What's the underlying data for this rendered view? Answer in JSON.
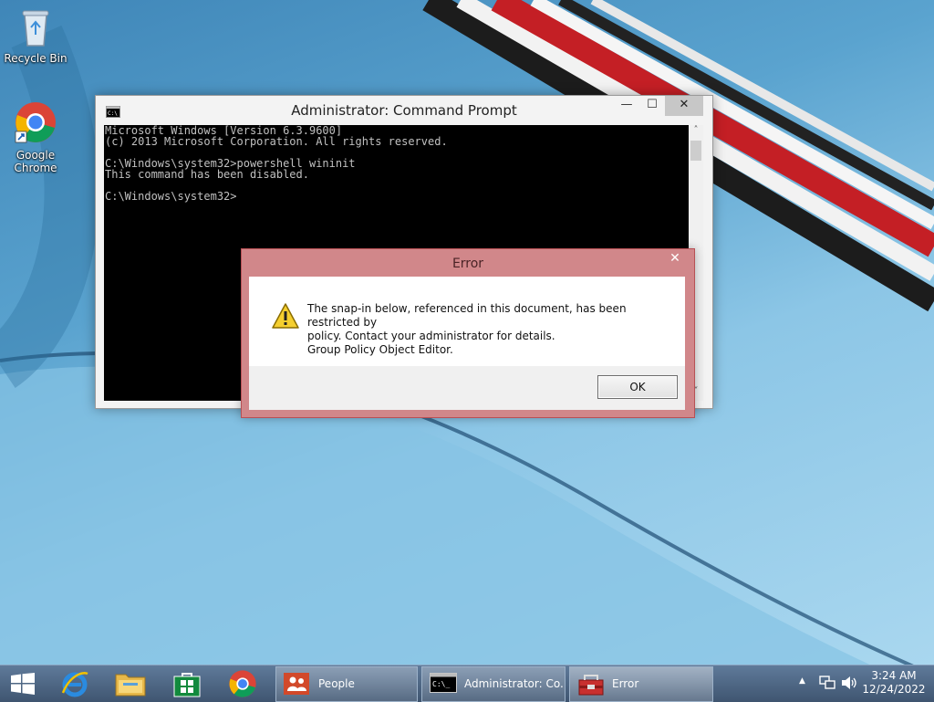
{
  "desktop": {
    "icons": [
      {
        "label": "Recycle Bin",
        "icon": "recycle-bin-icon"
      },
      {
        "label": "Google Chrome",
        "icon": "chrome-icon"
      }
    ]
  },
  "cmd": {
    "title": "Administrator: Command Prompt",
    "buttons": {
      "minimize": "—",
      "maximize": "☐",
      "close": "✕"
    },
    "console_text": "Microsoft Windows [Version 6.3.9600]\n(c) 2013 Microsoft Corporation. All rights reserved.\n\nC:\\Windows\\system32>powershell wininit\nThis command has been disabled.\n\nC:\\Windows\\system32>",
    "scroll_up": "˄",
    "scroll_down": "˅"
  },
  "error_dialog": {
    "title": "Error",
    "close": "✕",
    "message_line1": "The snap-in below, referenced in this document, has been restricted by",
    "message_line2": "policy. Contact your administrator for details.",
    "message_line3": "Group Policy Object Editor.",
    "ok_label": "OK"
  },
  "taskbar": {
    "pinned": [
      {
        "icon": "windows-start-icon"
      },
      {
        "icon": "internet-explorer-icon"
      },
      {
        "icon": "file-explorer-icon"
      },
      {
        "icon": "store-icon"
      },
      {
        "icon": "chrome-icon"
      }
    ],
    "tasks": [
      {
        "label": "People",
        "icon": "people-icon"
      },
      {
        "label": "Administrator: Co...",
        "icon": "cmd-icon"
      },
      {
        "label": "Error",
        "icon": "error-app-icon"
      }
    ],
    "tray": {
      "show_hidden": "▲",
      "network_icon": "network-icon",
      "volume_icon": "volume-icon"
    },
    "clock": {
      "time": "3:24 AM",
      "date": "12/24/2022"
    }
  },
  "colors": {
    "desktop_blue": "#5aa3cf",
    "error_frame": "#d1878a",
    "taskbar": "#4a5d76"
  }
}
